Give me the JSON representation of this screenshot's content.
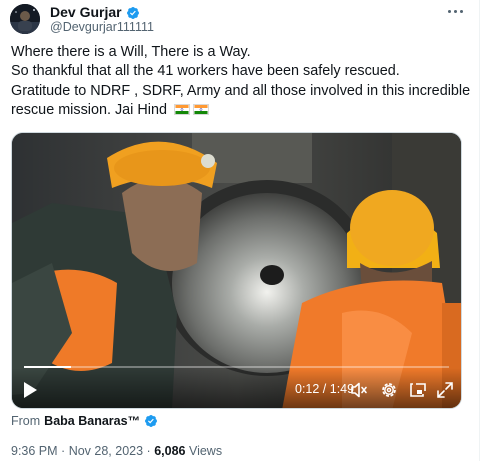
{
  "author": {
    "display_name": "Dev Gurjar",
    "handle": "@Devgurjar111111",
    "verified_icon": "verified-badge-icon"
  },
  "tweet": {
    "lines": [
      "Where there is a Will, There is a Way.",
      "So thankful that all the 41 workers have been safely rescued.",
      "Gratitude to NDRF , SDRF, Army and all those involved in this incredible",
      "rescue mission. Jai Hind"
    ],
    "emoji": [
      "india-flag-icon",
      "india-flag-icon"
    ]
  },
  "video": {
    "time_display": "0:12 / 1:49",
    "progress": 0.11,
    "controls": [
      "play-icon",
      "mute-icon",
      "settings-icon",
      "pip-icon",
      "fullscreen-icon"
    ]
  },
  "attribution": {
    "prefix": "From",
    "source": "Baba Banaras™"
  },
  "meta": {
    "time": "9:36 PM",
    "separator": "·",
    "date": "Nov 28, 2023",
    "views_count": "6,086",
    "views_label": "Views"
  },
  "colors": {
    "verified": "#1d9bf0",
    "secondary_text": "#536471",
    "helmet_orange": "#f0a020",
    "saffron": "#ff9933",
    "green": "#138808"
  }
}
